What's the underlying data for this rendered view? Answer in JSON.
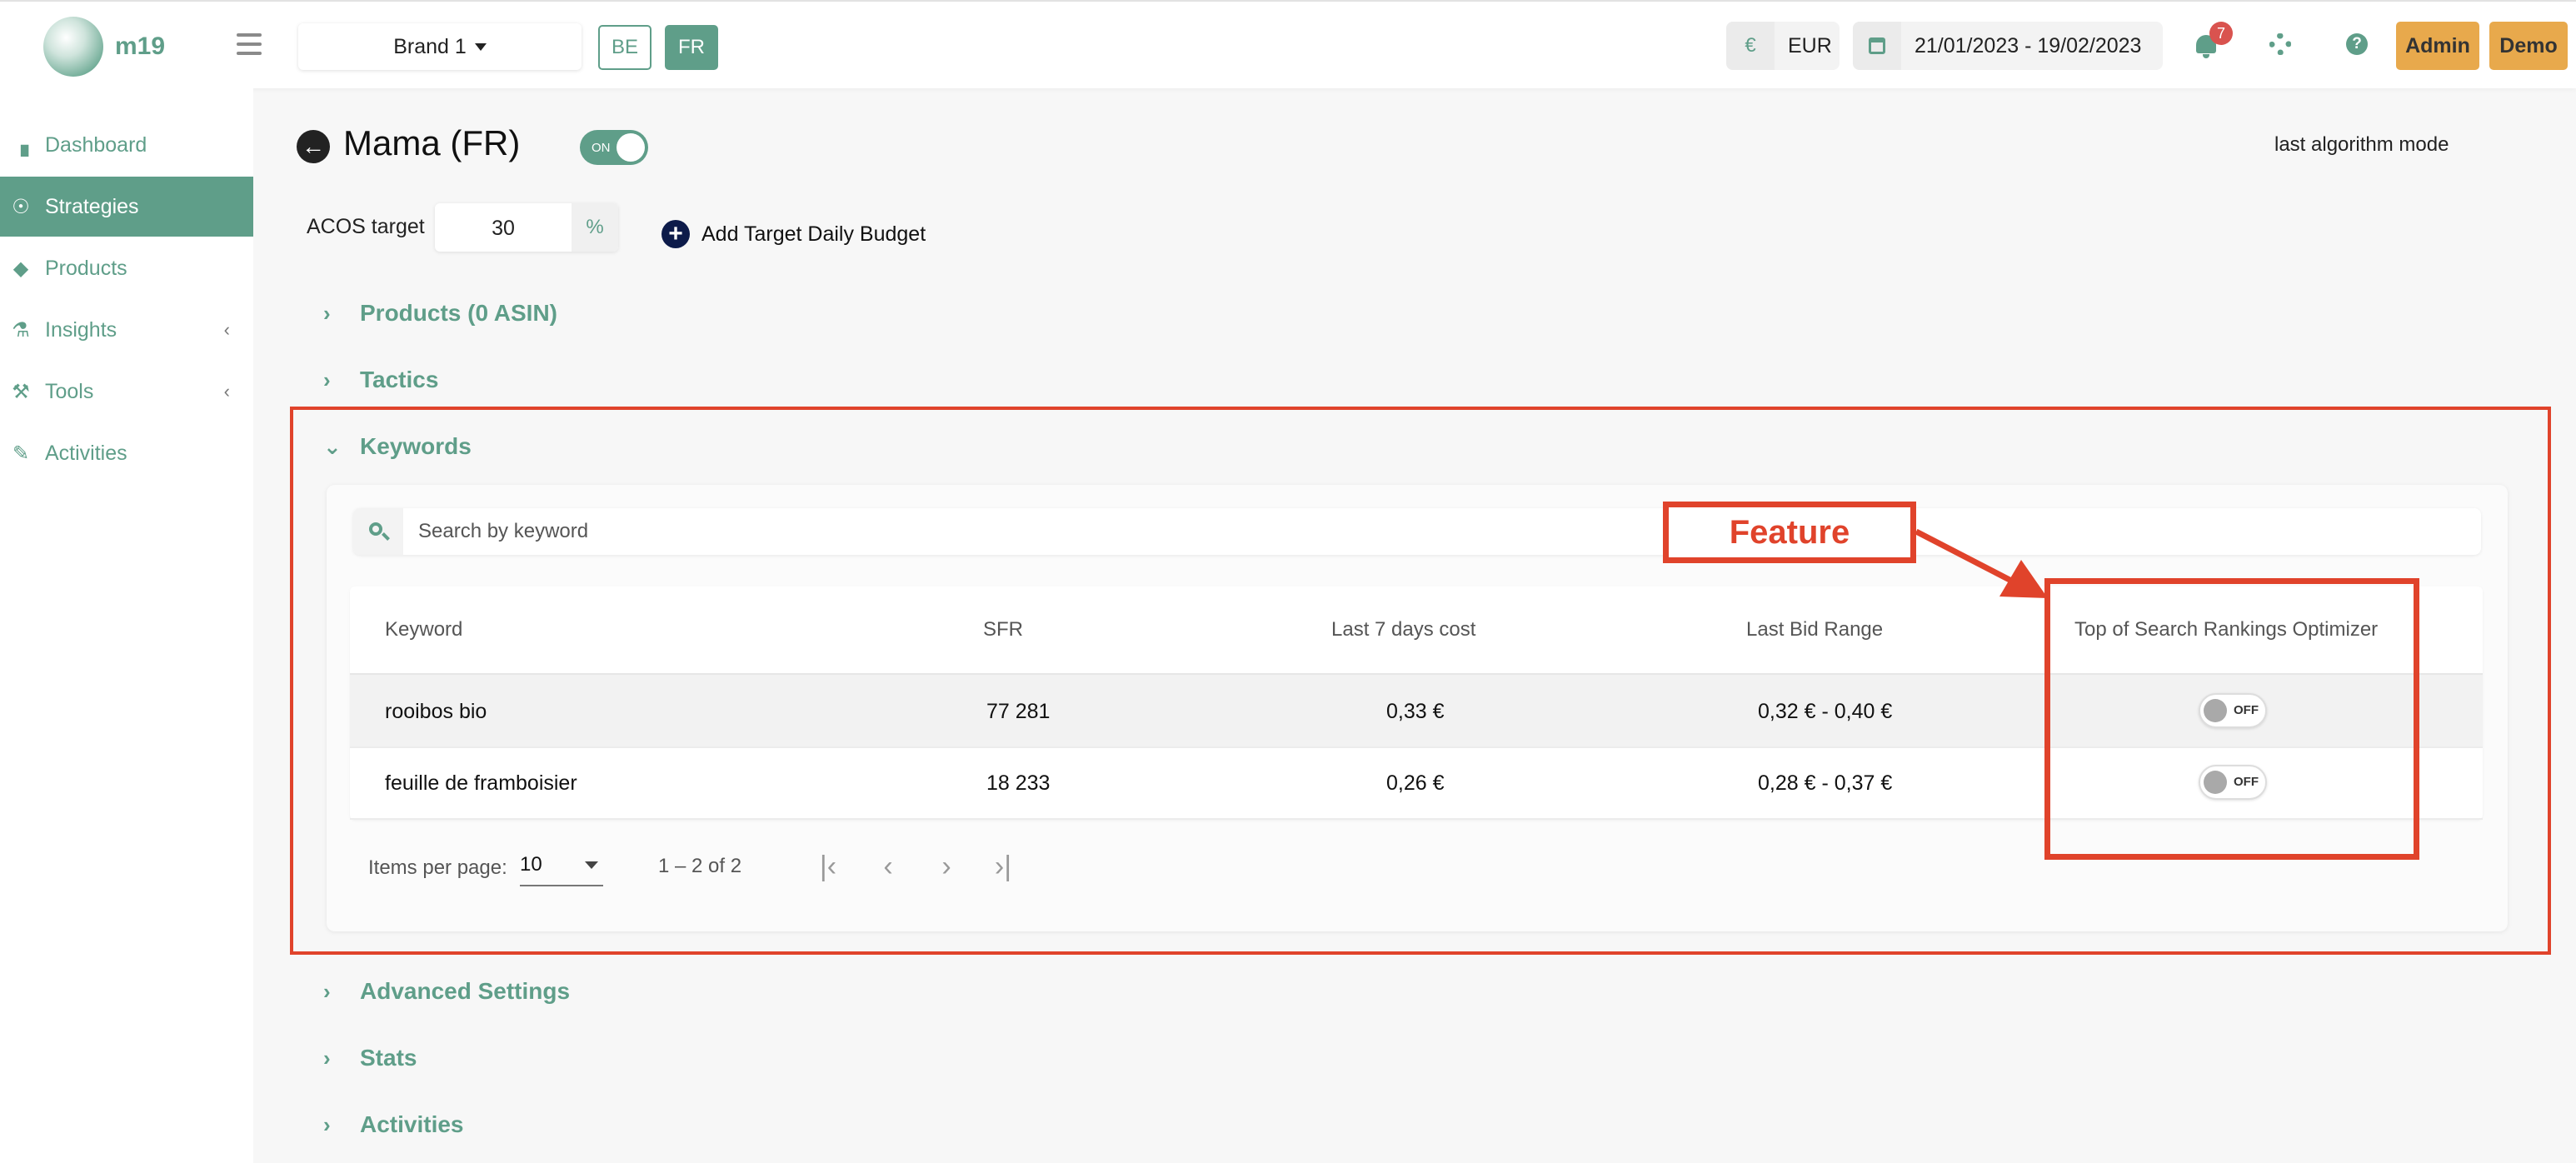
{
  "topbar": {
    "logo_text": "m19",
    "brand_selector": "Brand 1",
    "marketplaces": [
      {
        "code": "BE",
        "selected": false
      },
      {
        "code": "FR",
        "selected": true
      }
    ],
    "currency_symbol": "€",
    "currency": "EUR",
    "date_range": "21/01/2023 - 19/02/2023",
    "notifications_count": "7",
    "admin_label": "Admin",
    "demo_label": "Demo"
  },
  "sidebar": {
    "items": [
      {
        "label": "Dashboard",
        "icon": "bar-chart-icon",
        "active": false
      },
      {
        "label": "Strategies",
        "icon": "lightbulb-icon",
        "active": true
      },
      {
        "label": "Products",
        "icon": "tags-icon",
        "active": false
      },
      {
        "label": "Insights",
        "icon": "flask-icon",
        "active": false,
        "expandable": true
      },
      {
        "label": "Tools",
        "icon": "tools-icon",
        "active": false,
        "expandable": true
      },
      {
        "label": "Activities",
        "icon": "edit-icon",
        "active": false
      }
    ]
  },
  "strategy": {
    "title": "Mama (FR)",
    "status_toggle": "ON",
    "algorithm_mode": "last algorithm mode",
    "acos_label": "ACOS target",
    "acos_value": "30",
    "acos_unit": "%",
    "add_budget_label": "Add Target Daily Budget"
  },
  "sections": {
    "products": "Products (0 ASIN)",
    "tactics": "Tactics",
    "keywords": "Keywords",
    "advanced": "Advanced Settings",
    "stats": "Stats",
    "activities": "Activities"
  },
  "keywords": {
    "search_placeholder": "Search by keyword",
    "columns": [
      "Keyword",
      "SFR",
      "Last 7 days cost",
      "Last Bid Range",
      "Top of Search Rankings Optimizer"
    ],
    "rows": [
      {
        "keyword": "rooibos bio",
        "sfr": "77 281",
        "cost": "0,33 €",
        "bid_range": "0,32 € - 0,40 €",
        "optimizer": "OFF"
      },
      {
        "keyword": "feuille de framboisier",
        "sfr": "18 233",
        "cost": "0,26 €",
        "bid_range": "0,28 € - 0,37 €",
        "optimizer": "OFF"
      }
    ],
    "items_per_page_label": "Items per page:",
    "items_per_page_value": "10",
    "range_label": "1 – 2 of 2"
  },
  "annotation": {
    "label": "Feature",
    "color": "#e0432b"
  },
  "colors": {
    "accent": "#5f9e89",
    "brand_orange": "#e8a94c",
    "badge_red": "#d9534f"
  }
}
